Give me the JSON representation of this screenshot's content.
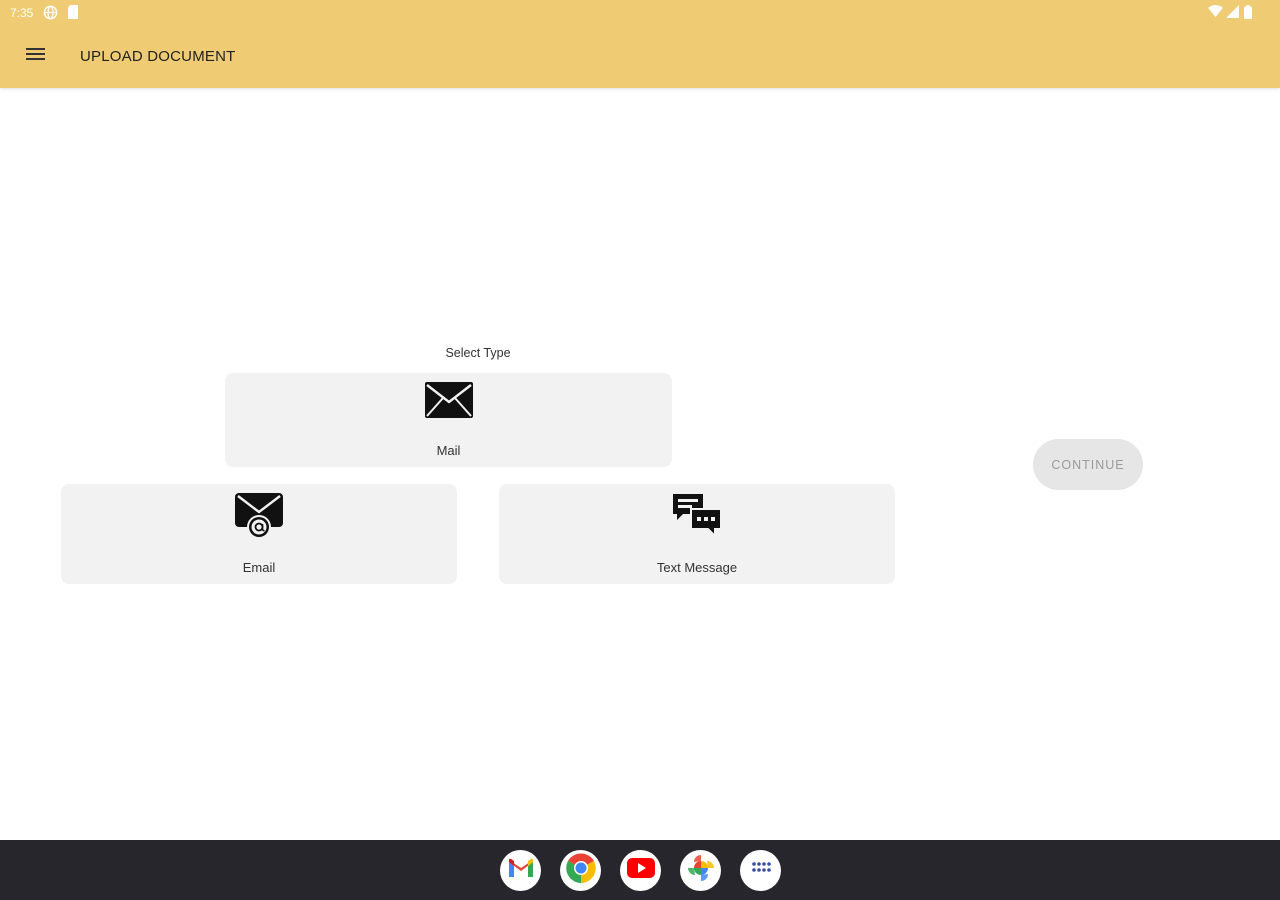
{
  "status_bar": {
    "time": "7:35",
    "icons": [
      "globe-icon",
      "sim-card-icon",
      "wifi-icon",
      "signal-icon",
      "battery-icon"
    ]
  },
  "app_bar": {
    "title": "UPLOAD DOCUMENT",
    "menu_icon": "hamburger-menu-icon",
    "background_color": "#efcc73"
  },
  "content": {
    "prompt": "Select Type",
    "options": [
      {
        "label": "Mail",
        "icon": "envelope-icon"
      },
      {
        "label": "Email",
        "icon": "email-at-icon"
      },
      {
        "label": "Text Message",
        "icon": "chat-bubbles-icon"
      }
    ],
    "continue_label": "CONTINUE",
    "card_color": "#f2f2f2"
  },
  "dock": {
    "apps": [
      {
        "name": "Gmail",
        "icon": "gmail-icon"
      },
      {
        "name": "Chrome",
        "icon": "chrome-icon"
      },
      {
        "name": "YouTube",
        "icon": "youtube-icon"
      },
      {
        "name": "Photos",
        "icon": "photos-icon"
      },
      {
        "name": "App drawer",
        "icon": "app-drawer-icon"
      }
    ],
    "background_color": "#26262c"
  }
}
